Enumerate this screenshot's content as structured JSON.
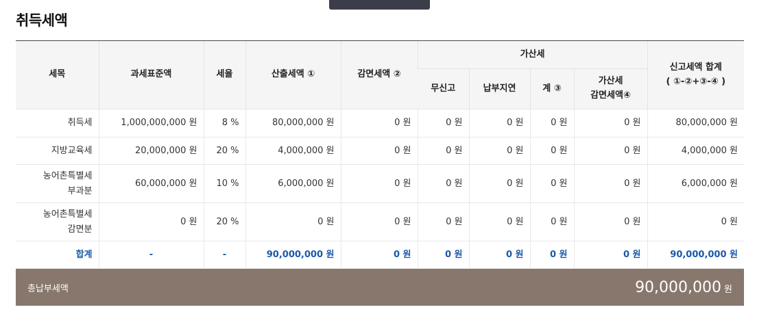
{
  "section_title": "취득세액",
  "headers": {
    "item": "세목",
    "base": "과세표준액",
    "rate": "세율",
    "calc": "산출세액 ①",
    "reduction": "감면세액 ②",
    "penalty": "가산세",
    "nonfiling": "무신고",
    "late": "납부지연",
    "subtotal": "계 ③",
    "penalty_reduction_line1": "가산세",
    "penalty_reduction_line2": "감면세액④",
    "report_total_line1": "신고세액 합계",
    "report_total_line2": "( ①-②+③-④ )"
  },
  "rows": [
    {
      "item_line1": "취득세",
      "item_line2": "",
      "base": "1,000,000,000 원",
      "rate": "8 %",
      "calc": "80,000,000 원",
      "reduction": "0 원",
      "nonfiling": "0 원",
      "late": "0 원",
      "subtotal": "0 원",
      "penalty_reduction": "0 원",
      "total": "80,000,000 원"
    },
    {
      "item_line1": "지방교육세",
      "item_line2": "",
      "base": "20,000,000 원",
      "rate": "20 %",
      "calc": "4,000,000 원",
      "reduction": "0 원",
      "nonfiling": "0 원",
      "late": "0 원",
      "subtotal": "0 원",
      "penalty_reduction": "0 원",
      "total": "4,000,000 원"
    },
    {
      "item_line1": "농어촌특별세",
      "item_line2": "부과분",
      "base": "60,000,000 원",
      "rate": "10 %",
      "calc": "6,000,000 원",
      "reduction": "0 원",
      "nonfiling": "0 원",
      "late": "0 원",
      "subtotal": "0 원",
      "penalty_reduction": "0 원",
      "total": "6,000,000 원"
    },
    {
      "item_line1": "농어촌특별세",
      "item_line2": "감면분",
      "base": "0 원",
      "rate": "20 %",
      "calc": "0 원",
      "reduction": "0 원",
      "nonfiling": "0 원",
      "late": "0 원",
      "subtotal": "0 원",
      "penalty_reduction": "0 원",
      "total": "0 원"
    }
  ],
  "sum_row": {
    "label": "합계",
    "base": "-",
    "rate": "-",
    "calc": "90,000,000 원",
    "reduction": "0 원",
    "nonfiling": "0 원",
    "late": "0 원",
    "subtotal": "0 원",
    "penalty_reduction": "0 원",
    "total": "90,000,000 원"
  },
  "total_bar": {
    "label": "총납부세액",
    "amount": "90,000,000",
    "unit": "원"
  },
  "colors": {
    "accent_blue": "#1a5aa8",
    "total_bar_bg": "#87776c",
    "top_tab": "#3b3d4a"
  }
}
